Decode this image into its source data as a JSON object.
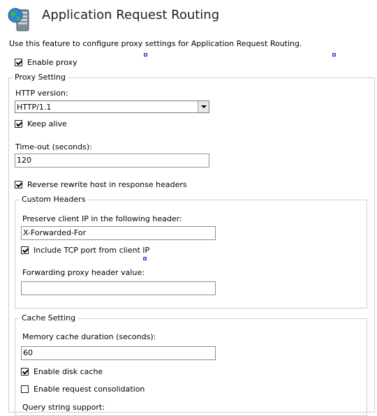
{
  "header": {
    "icon": "server-globe-icon",
    "title": "Application Request Routing",
    "description": "Use this feature to configure proxy settings for Application Request Routing."
  },
  "enable_proxy": {
    "label": "Enable proxy",
    "checked": true
  },
  "proxy_setting": {
    "legend": "Proxy Setting",
    "http_version_label": "HTTP version:",
    "http_version_value": "HTTP/1.1",
    "keep_alive_label": "Keep alive",
    "timeout_label": "Time-out (seconds):",
    "timeout_value": "120",
    "reverse_rewrite_label": "Reverse rewrite host in response headers"
  },
  "custom_headers": {
    "legend": "Custom Headers",
    "preserve_ip_label": "Preserve client IP in the following header:",
    "preserve_ip_value": "X-Forwarded-For",
    "include_tcp_port_label": "Include TCP port from client IP",
    "forwarding_proxy_label": "Forwarding proxy header value:",
    "forwarding_proxy_value": ""
  },
  "cache_setting": {
    "legend": "Cache Setting",
    "memory_cache_label": "Memory cache duration (seconds):",
    "memory_cache_value": "60",
    "enable_disk_cache_label": "Enable disk cache",
    "request_consolidation_label": "Enable request consolidation",
    "query_string_label": "Query string support:"
  }
}
